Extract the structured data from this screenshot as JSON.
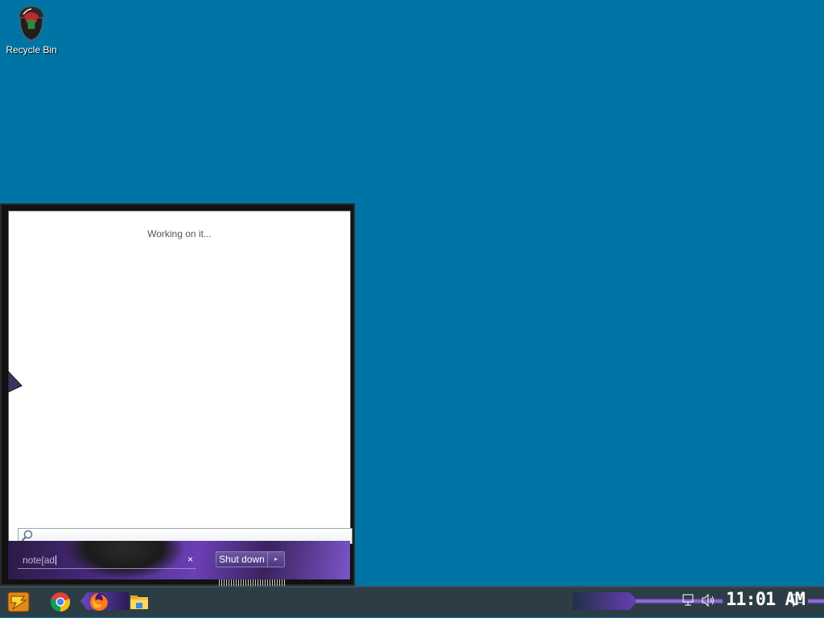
{
  "desktop": {
    "background_color": "#0074a4",
    "icons": [
      {
        "label": "Recycle Bin",
        "icon": "recycle-bin-icon"
      }
    ]
  },
  "start_menu": {
    "status_text": "Working on it...",
    "search_box": {
      "value": "note[ad",
      "clear_icon": "×"
    },
    "shutdown": {
      "label": "Shut down",
      "arrow": "▸"
    }
  },
  "taskbar": {
    "start_icon": "start-orb-icon",
    "pinned": [
      {
        "name": "Google Chrome",
        "icon": "chrome-icon"
      },
      {
        "name": "Firefox",
        "icon": "firefox-icon"
      },
      {
        "name": "File Explorer",
        "icon": "folder-icon"
      }
    ],
    "tray": {
      "network_icon": "network-icon",
      "volume_icon": "volume-icon",
      "clock": "11:01 AM",
      "notification_icon": "action-center-icon"
    },
    "colors": {
      "accent": "#6b47c0",
      "bar": "#2d3d45"
    }
  }
}
